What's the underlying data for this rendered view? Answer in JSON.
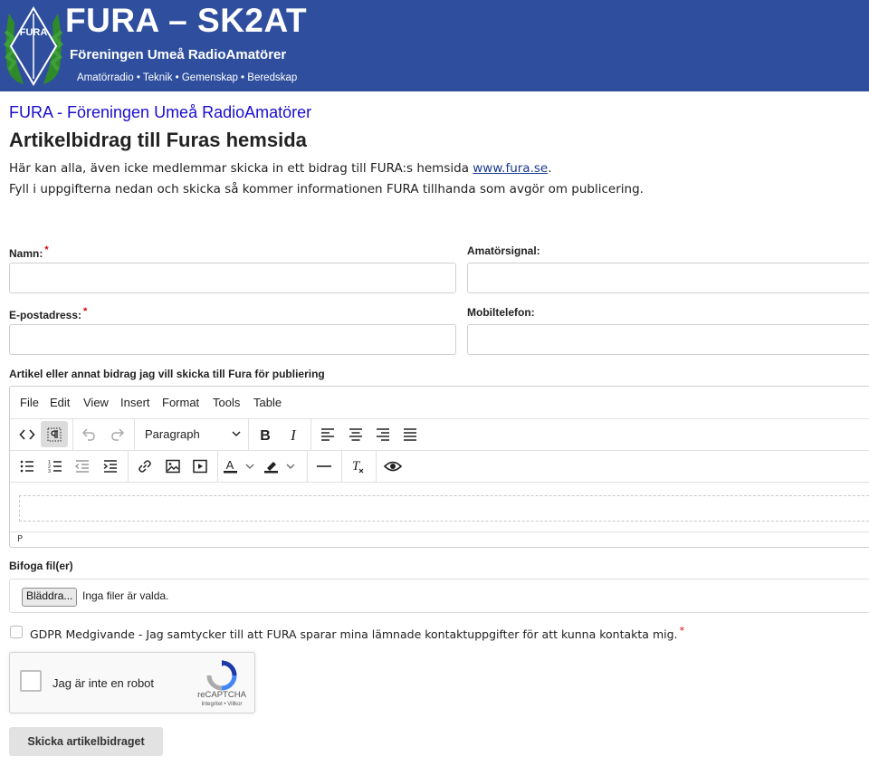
{
  "banner": {
    "title": "FURA – SK2AT",
    "subtitle": "Föreningen Umeå RadioAmatörer",
    "tagline": "Amatörradio • Teknik • Gemenskap • Beredskap",
    "logo_text": "FURA"
  },
  "site_link": "FURA - Föreningen Umeå RadioAmatörer",
  "page_title": "Artikelbidrag till Furas hemsida",
  "intro": {
    "line1_prefix": "Här kan alla, även icke medlemmar skicka in ett bidrag till FURA:s hemsida ",
    "line1_link": "www.fura.se",
    "line1_suffix": ".",
    "line2": "Fyll i uppgifterna nedan och skicka så kommer informationen FURA tillhanda som avgör om publicering."
  },
  "form": {
    "name_label": "Namn:",
    "callsign_label": "Amatörsignal:",
    "email_label": "E-postadress:",
    "mobile_label": "Mobiltelefon:",
    "required_mark": "*",
    "article_label": "Artikel eller annat bidrag jag vill skicka till Fura för publiering",
    "attach_label": "Bifoga fil(er)",
    "browse_label": "Bläddra...",
    "no_files": "Inga filer är valda.",
    "gdpr_text": "GDPR Medgivande - Jag samtycker till att FURA sparar mina lämnade kontaktuppgifter för att kunna kontakta mig.",
    "submit_label": "Skicka artikelbidraget"
  },
  "editor": {
    "menu": [
      "File",
      "Edit",
      "View",
      "Insert",
      "Format",
      "Tools",
      "Table"
    ],
    "block_format": "Paragraph",
    "status_path": "P"
  },
  "captcha": {
    "label": "Jag är inte en robot",
    "brand": "reCAPTCHA",
    "links": "Integritet • Villkor"
  },
  "colors": {
    "banner_bg": "#2f4f9e",
    "link": "#1a0dcf",
    "required": "#dd0000",
    "submit_bg": "#e2e2e2"
  }
}
